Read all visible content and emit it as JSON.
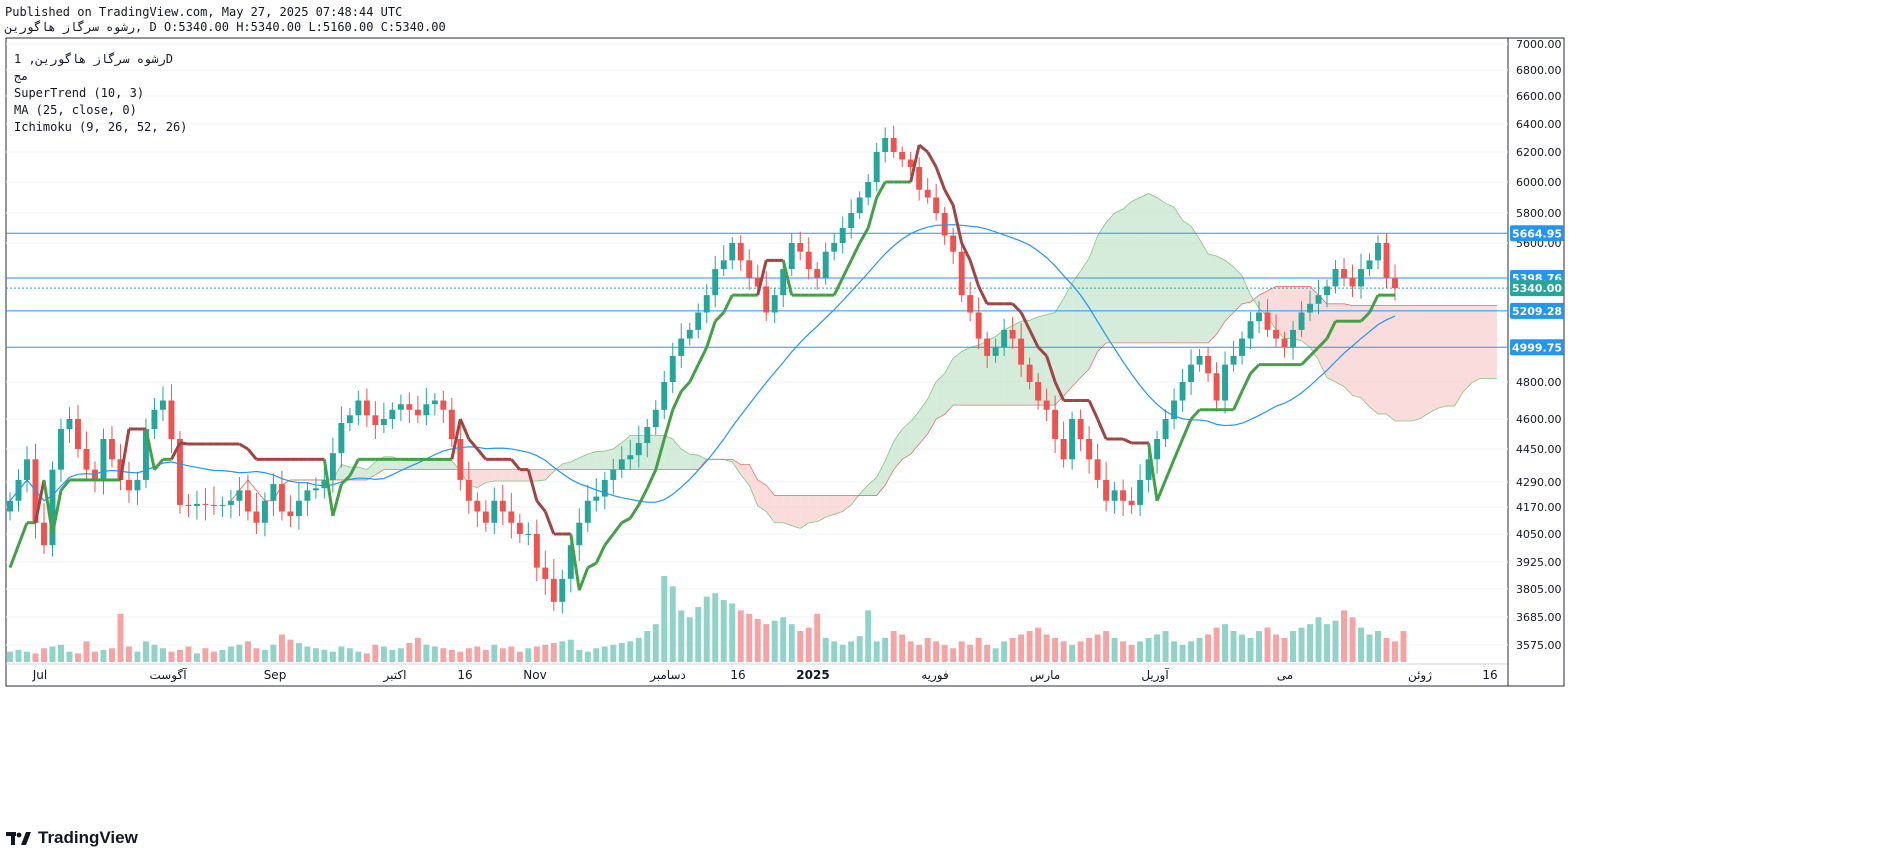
{
  "header": {
    "published": "Published on TradingView.com, May 27, 2025 07:48:44 UTC",
    "symbol_line": "رشوه سرگاز هاگورین, D O:5340.00 H:5340.00 L:5160.00 C:5340.00"
  },
  "legend": {
    "symbol": "رشوه سرگاز هاگورین, 1D",
    "sub": "مج",
    "supertrend": "SuperTrend (10, 3)",
    "ma": "MA (25, close, 0)",
    "ichimoku": "Ichimoku (9, 26, 52, 26)"
  },
  "brand": {
    "name": "TradingView",
    "icon": "tradingview-logo-icon"
  },
  "colors": {
    "up": "#26a69a",
    "down": "#ef5350",
    "up_vol": "#8fd3c9",
    "down_vol": "#f5a3a3",
    "supertrend_up": "#43a047",
    "supertrend_down": "#a04444",
    "ma": "#2196f3",
    "cloud_green": "#b7dfbf",
    "cloud_red": "#f8c4c4",
    "hline": "#2196f3",
    "last_price": "#26a69a"
  },
  "chart_data": {
    "type": "candlestick",
    "timeframe": "1D",
    "y_axis_ticks": [
      7000,
      6800,
      6600,
      6400,
      6200,
      6000,
      5800,
      5600,
      4800,
      4600,
      4450,
      4290,
      4170,
      4050,
      3925,
      3805,
      3685,
      3575
    ],
    "y_range": [
      3500,
      7050
    ],
    "x_axis_labels": [
      "Jul",
      "آگوست",
      "Sep",
      "اکتبر",
      "16",
      "Nov",
      "دسامبر",
      "16",
      "2025",
      "فوریه",
      "مارس",
      "آوریل",
      "می",
      "ژوئن",
      "16"
    ],
    "ohlc": {
      "open": 5340.0,
      "high": 5340.0,
      "low": 5160.0,
      "close": 5340.0
    },
    "horizontal_lines": [
      5664.95,
      5398.76,
      5209.28,
      4999.75
    ],
    "last_price": 5340.0,
    "price_labels": [
      "5664.95",
      "5398.76",
      "5340.00",
      "5209.28",
      "4999.75"
    ],
    "closes": [
      4200,
      4300,
      4400,
      4100,
      4000,
      4350,
      4550,
      4600,
      4450,
      4350,
      4300,
      4500,
      4400,
      4300,
      4250,
      4300,
      4550,
      4650,
      4700,
      4500,
      4180,
      4175,
      4185,
      4180,
      4175,
      4180,
      4200,
      4250,
      4150,
      4100,
      4200,
      4280,
      4150,
      4130,
      4200,
      4250,
      4260,
      4300,
      4430,
      4580,
      4620,
      4700,
      4620,
      4570,
      4600,
      4650,
      4680,
      4650,
      4620,
      4680,
      4700,
      4650,
      4500,
      4300,
      4200,
      4150,
      4100,
      4200,
      4150,
      4100,
      4050,
      4050,
      3900,
      3850,
      3750,
      3850,
      4000,
      4100,
      4200,
      4220,
      4300,
      4350,
      4400,
      4420,
      4480,
      4560,
      4650,
      4800,
      4950,
      5050,
      5100,
      5200,
      5300,
      5450,
      5500,
      5600,
      5500,
      5400,
      5350,
      5200,
      5300,
      5450,
      5600,
      5550,
      5450,
      5400,
      5550,
      5600,
      5700,
      5800,
      5900,
      6000,
      6200,
      6300,
      6200,
      6150,
      6100,
      5950,
      5900,
      5800,
      5650,
      5550,
      5300,
      5200,
      5050,
      4950,
      5000,
      5100,
      5050,
      4900,
      4800,
      4700,
      4650,
      4500,
      4400,
      4600,
      4500,
      4400,
      4300,
      4200,
      4250,
      4200,
      4180,
      4300,
      4400,
      4500,
      4600,
      4700,
      4800,
      4900,
      4950,
      4850,
      4700,
      4900,
      4950,
      5050,
      5150,
      5200,
      5100,
      5050,
      5000,
      5100,
      5200,
      5250,
      5300,
      5350,
      5450,
      5400,
      5350,
      5450,
      5500,
      5600,
      5400,
      5340
    ],
    "volumes": [
      6,
      7,
      6,
      5,
      8,
      9,
      10,
      6,
      5,
      12,
      6,
      7,
      8,
      28,
      9,
      6,
      12,
      10,
      8,
      6,
      7,
      9,
      5,
      8,
      6,
      7,
      9,
      10,
      12,
      8,
      7,
      10,
      16,
      13,
      11,
      9,
      8,
      7,
      6,
      9,
      8,
      6,
      5,
      10,
      9,
      7,
      8,
      11,
      14,
      10,
      9,
      8,
      7,
      6,
      8,
      9,
      7,
      10,
      8,
      9,
      6,
      8,
      9,
      10,
      11,
      12,
      13,
      7,
      6,
      8,
      9,
      10,
      11,
      12,
      14,
      18,
      22,
      50,
      44,
      30,
      26,
      32,
      38,
      40,
      36,
      34,
      30,
      28,
      25,
      22,
      24,
      26,
      22,
      18,
      20,
      28,
      14,
      12,
      10,
      12,
      15,
      30,
      12,
      14,
      18,
      16,
      12,
      10,
      14,
      12,
      10,
      8,
      12,
      10,
      14,
      10,
      8,
      12,
      14,
      16,
      18,
      20,
      16,
      14,
      12,
      10,
      12,
      14,
      16,
      18,
      14,
      12,
      10,
      12,
      14,
      16,
      18,
      12,
      10,
      12,
      14,
      16,
      20,
      22,
      18,
      16,
      14,
      18,
      20,
      16,
      14,
      18,
      20,
      22,
      26,
      22,
      24,
      30,
      26,
      20,
      16,
      18,
      14,
      12,
      18
    ]
  }
}
